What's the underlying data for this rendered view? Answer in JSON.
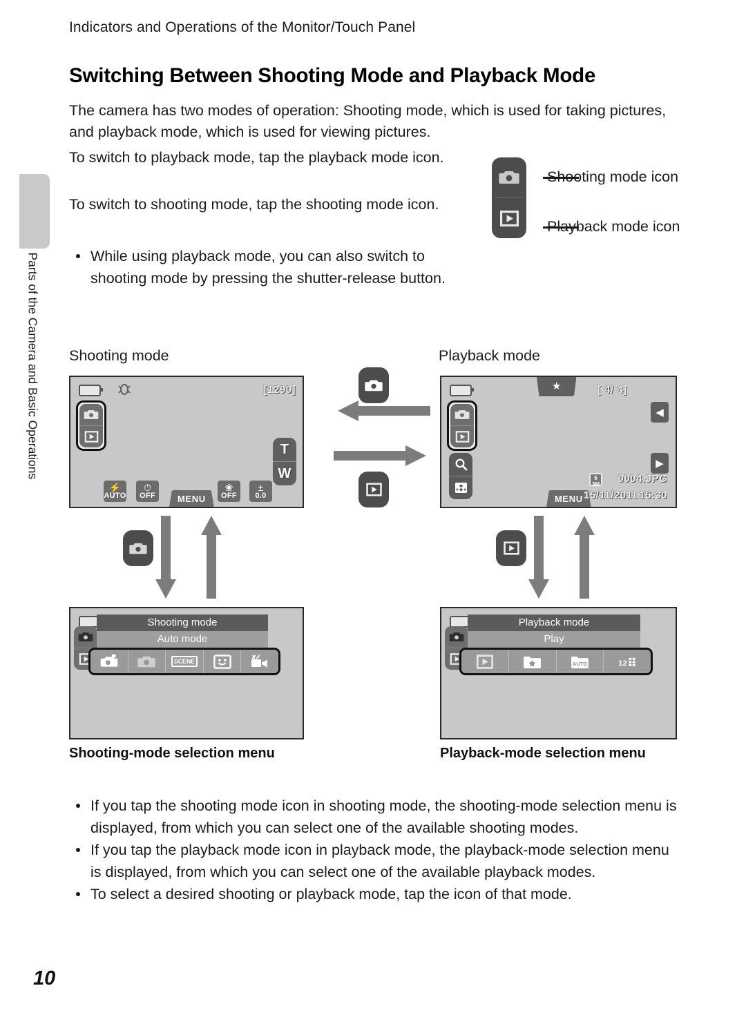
{
  "page": {
    "running_head": "Indicators and Operations of the Monitor/Touch Panel",
    "side_tab_label": "Parts of the Camera and Basic Operations",
    "page_number": "10"
  },
  "section": {
    "title": "Switching Between Shooting Mode and Playback Mode",
    "intro": "The camera has two modes of operation: Shooting mode, which is used for taking pictures, and playback mode, which is used for viewing pictures.",
    "switch_to_playback": "To switch to playback mode, tap the playback mode icon.",
    "switch_to_shooting": "To switch to shooting mode, tap the shooting mode icon.",
    "bullets_top": [
      "While using playback mode, you can also switch to shooting mode by pressing the shutter-release button."
    ],
    "bullets_bottom": [
      "If you tap the shooting mode icon in shooting mode, the shooting-mode selection menu is displayed, from which you can select one of the available shooting modes.",
      "If you tap the playback mode icon in playback mode, the playback-mode selection menu is displayed, from which you can select one of the available playback modes.",
      "To select a desired shooting or playback mode, tap the icon of that mode."
    ]
  },
  "callout": {
    "shooting_label": "Shooting mode icon",
    "playback_label": "Playback mode icon"
  },
  "figure": {
    "shooting_label": "Shooting mode",
    "playback_label": "Playback mode",
    "shooting_menu_caption": "Shooting-mode selection menu",
    "playback_menu_caption": "Playback-mode selection menu"
  },
  "shooting_screen": {
    "shots_remaining": "[1290]",
    "zoom_tele": "T",
    "zoom_wide": "W",
    "menu_label": "MENU",
    "toolbar": [
      {
        "name": "flash-mode",
        "glyph": "⚡",
        "caption": "AUTO"
      },
      {
        "name": "self-timer",
        "glyph": "⏱",
        "caption": "OFF"
      },
      {
        "name": "macro-mode",
        "glyph": "❀",
        "caption": "OFF"
      },
      {
        "name": "exposure-compensation",
        "glyph": "±",
        "caption": "0.0"
      }
    ]
  },
  "playback_screen": {
    "favorites_glyph": "★",
    "frame_counter": "[    4/    4]",
    "menu_label": "MENU",
    "image_size": "5 3 M",
    "file_name": "0004.JPG",
    "date": "15/11/2011",
    "time": "15:30"
  },
  "shooting_menu": {
    "title": "Shooting mode",
    "subtitle": "Auto mode",
    "items": [
      {
        "name": "easy-auto-mode-icon",
        "label": "Easy auto mode"
      },
      {
        "name": "auto-mode-icon",
        "label": "Auto mode"
      },
      {
        "name": "scene-mode-icon",
        "label": "SCENE"
      },
      {
        "name": "smart-portrait-mode-icon",
        "label": "Smart portrait"
      },
      {
        "name": "movie-mode-icon",
        "label": "Movie"
      }
    ]
  },
  "playback_menu": {
    "title": "Playback mode",
    "subtitle": "Play",
    "items": [
      {
        "name": "play-mode-icon",
        "label": "Play"
      },
      {
        "name": "favorite-pictures-icon",
        "label": "Favorite pictures"
      },
      {
        "name": "auto-sort-icon",
        "label": "AUTO"
      },
      {
        "name": "list-by-date-icon",
        "label": "12"
      }
    ]
  },
  "colors": {
    "page_bg": "#ffffff",
    "screen_bg": "#c8c8c8",
    "ui_dark": "#4c4c4c",
    "ui_mid": "#6b6b6b",
    "arrow_gray": "#7c7c7c",
    "tab_gray": "#c9c9c9"
  }
}
